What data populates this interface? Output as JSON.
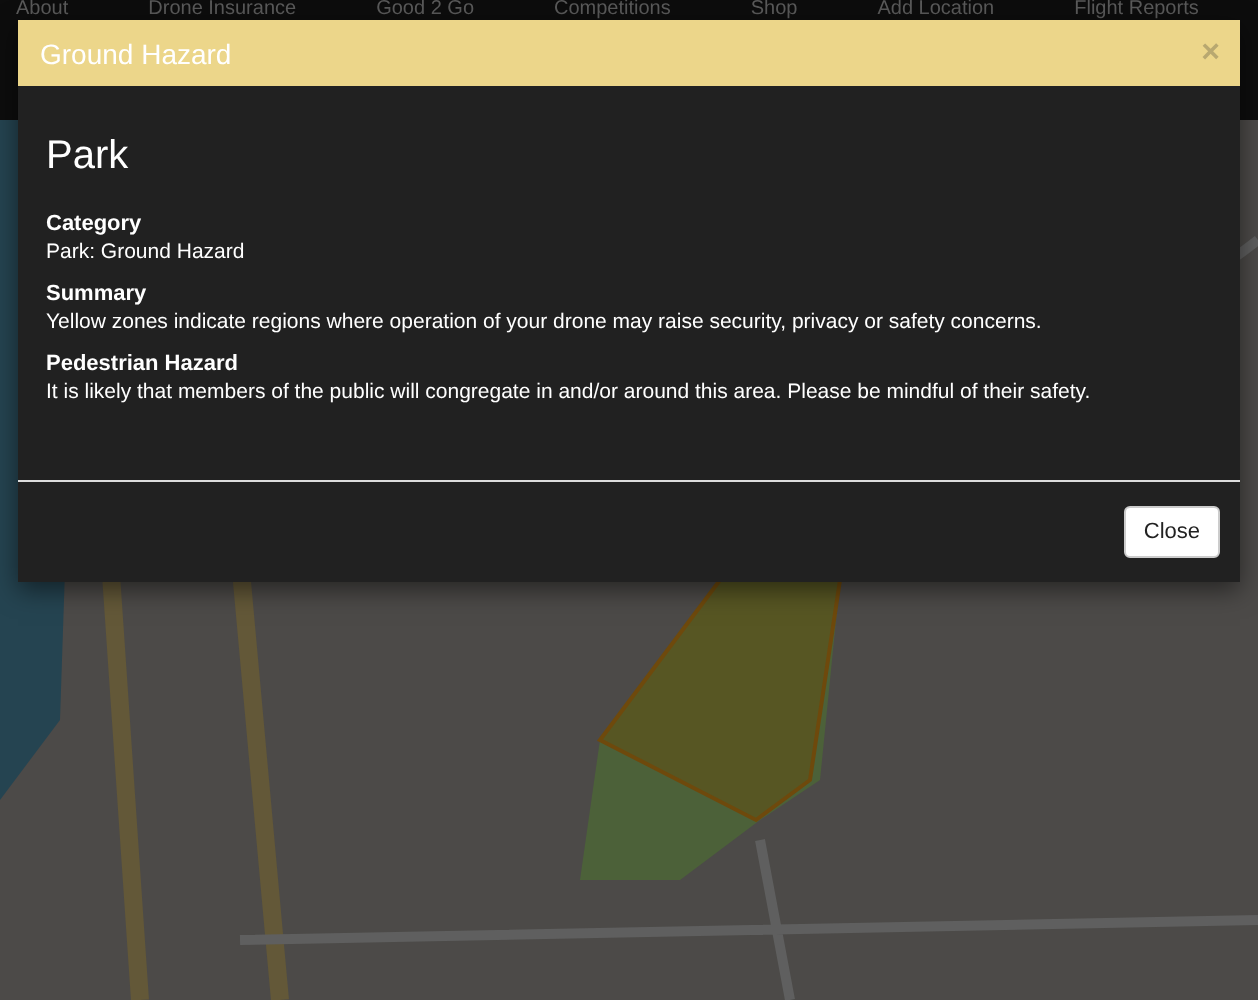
{
  "nav": {
    "items": [
      "About",
      "Drone Insurance",
      "Good 2 Go",
      "Competitions",
      "Shop",
      "Add Location",
      "Flight Reports"
    ]
  },
  "modal": {
    "header": "Ground Hazard",
    "close_icon": "×",
    "title": "Park",
    "sections": [
      {
        "heading": "Category",
        "text": "Park: Ground Hazard"
      },
      {
        "heading": "Summary",
        "text": "Yellow zones indicate regions where operation of your drone may raise security, privacy or safety concerns."
      },
      {
        "heading": "Pedestrian Hazard",
        "text": "It is likely that members of the public will congregate in and/or around this area. Please be mindful of their safety."
      }
    ],
    "button": "Close"
  }
}
